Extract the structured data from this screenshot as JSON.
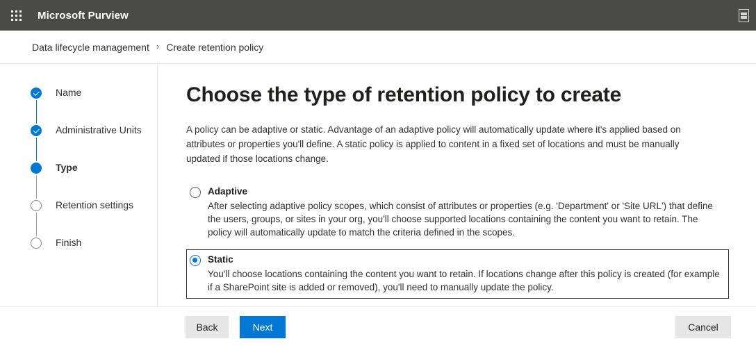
{
  "suite": {
    "app_launcher_icon": "waffle-grid-icon",
    "title": "Microsoft Purview",
    "right_icon": "feedback-glyph-icon"
  },
  "breadcrumb": {
    "separator": "›",
    "items": [
      {
        "label": "Data lifecycle management",
        "current": false
      },
      {
        "label": "Create retention policy",
        "current": true
      }
    ]
  },
  "wizard": {
    "steps": [
      {
        "label": "Name",
        "state": "done"
      },
      {
        "label": "Administrative Units",
        "state": "done"
      },
      {
        "label": "Type",
        "state": "active"
      },
      {
        "label": "Retention settings",
        "state": "todo"
      },
      {
        "label": "Finish",
        "state": "todo"
      }
    ]
  },
  "main": {
    "title": "Choose the type of retention policy to create",
    "intro": "A policy can be adaptive or static. Advantage of an adaptive policy will automatically update where it's applied based on attributes or properties you'll define. A static policy is applied to content in a fixed set of locations and must be manually updated if those locations change.",
    "options": [
      {
        "id": "adaptive",
        "title": "Adaptive",
        "description": "After selecting adaptive policy scopes, which consist of attributes or properties (e.g. 'Department' or 'Site URL') that define the users, groups, or sites in your org, you'll choose supported locations containing the content you want to retain. The policy will automatically update to match the criteria defined in the scopes.",
        "selected": false
      },
      {
        "id": "static",
        "title": "Static",
        "description": "You'll choose locations containing the content you want to retain. If locations change after this policy is created (for example if a SharePoint site is added or removed), you'll need to manually update the policy.",
        "selected": true
      }
    ]
  },
  "footer": {
    "back_label": "Back",
    "next_label": "Next",
    "cancel_label": "Cancel"
  },
  "colors": {
    "accent": "#0078d4",
    "suitebar": "#4a4a48",
    "text": "#323130",
    "button_standard": "#e6e6e6",
    "border": "#ebebeb"
  }
}
